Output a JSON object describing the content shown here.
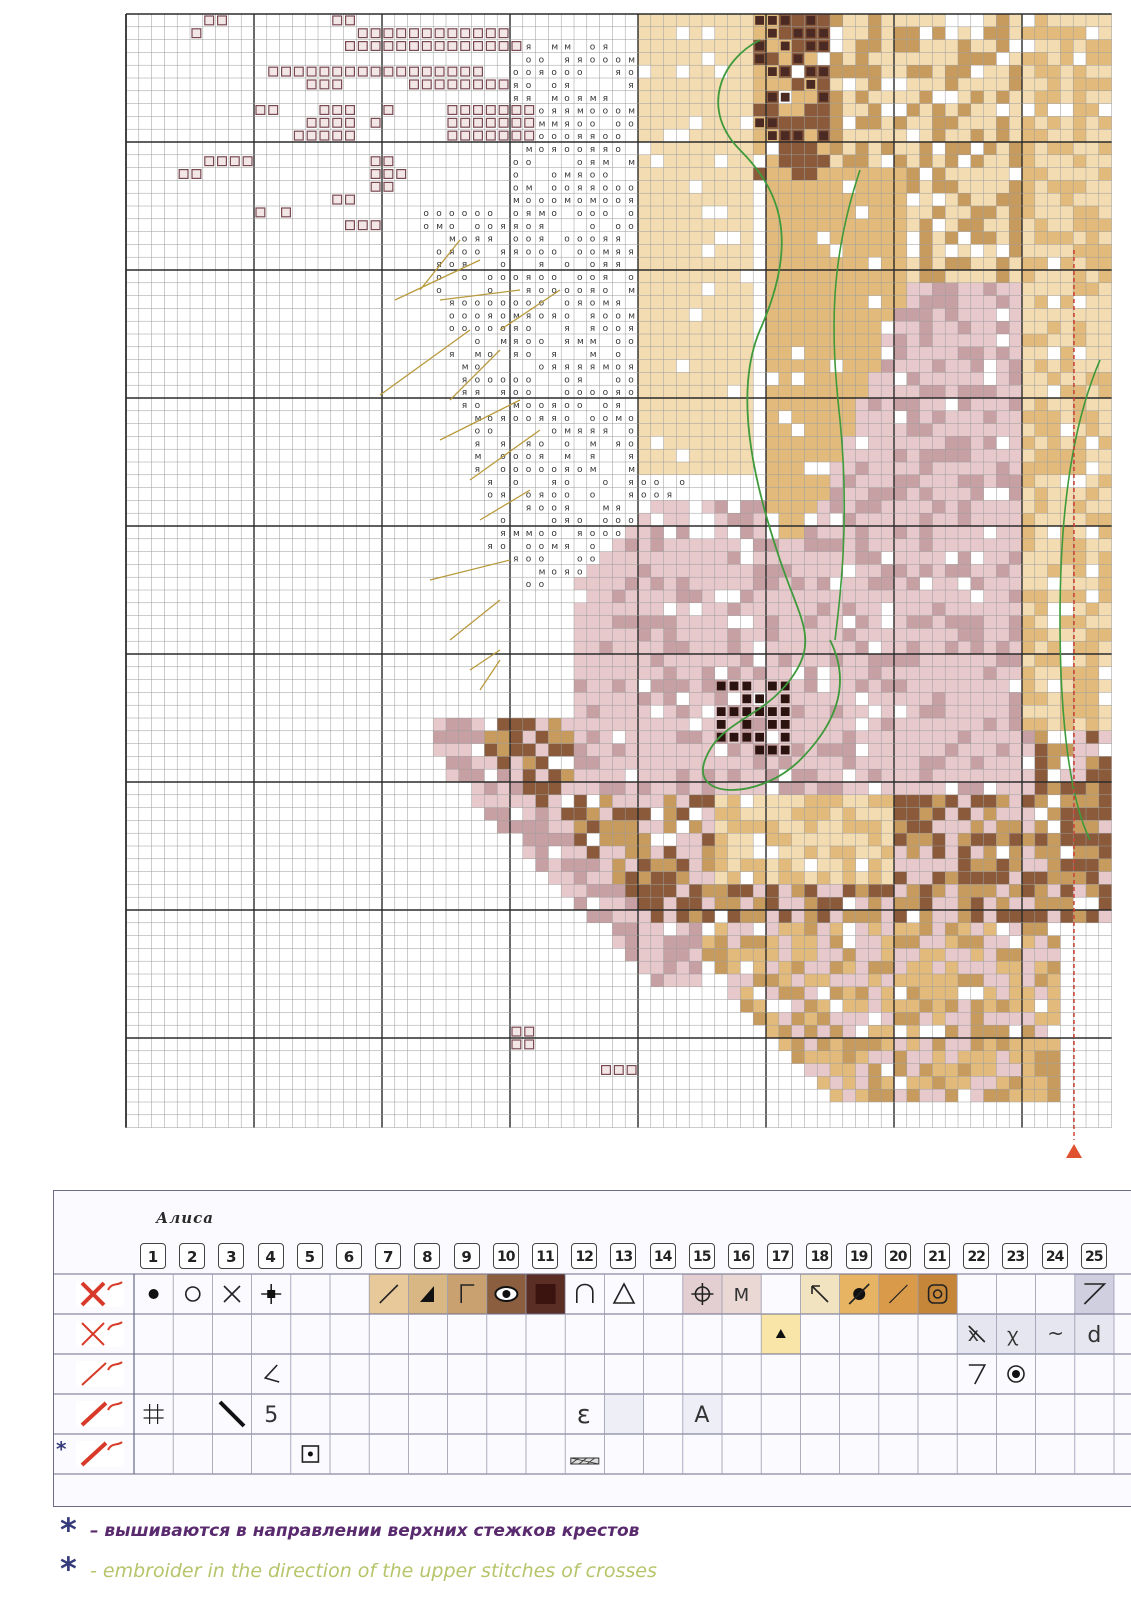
{
  "brand": {
    "logo_text": "Алиса"
  },
  "legend": {
    "column_numbers": [
      "1",
      "2",
      "3",
      "4",
      "5",
      "6",
      "7",
      "8",
      "9",
      "10",
      "11",
      "12",
      "13",
      "14",
      "15",
      "16",
      "17",
      "18",
      "19",
      "20",
      "21",
      "22",
      "23",
      "24",
      "25"
    ]
  },
  "notes": {
    "ru": "– вышиваются в направлении верхних стежков крестов",
    "en": "- embroider in the direction of the upper stitches of crosses",
    "star": "*"
  },
  "colors": {
    "grid_line": "#9a9a9a",
    "grid_major": "#2b2b2b",
    "tan_light": "#f3dcb2",
    "tan": "#e2bb7c",
    "tan_dark": "#c79b5d",
    "brown": "#8a5a3a",
    "brown_dark": "#5a2e24",
    "pink": "#e7c9cc",
    "pink_dark": "#c7a0a4",
    "backstitch_green": "#3e9a3a",
    "backstitch_gold": "#b99a3c",
    "backstitch_red": "#d03a2a"
  }
}
